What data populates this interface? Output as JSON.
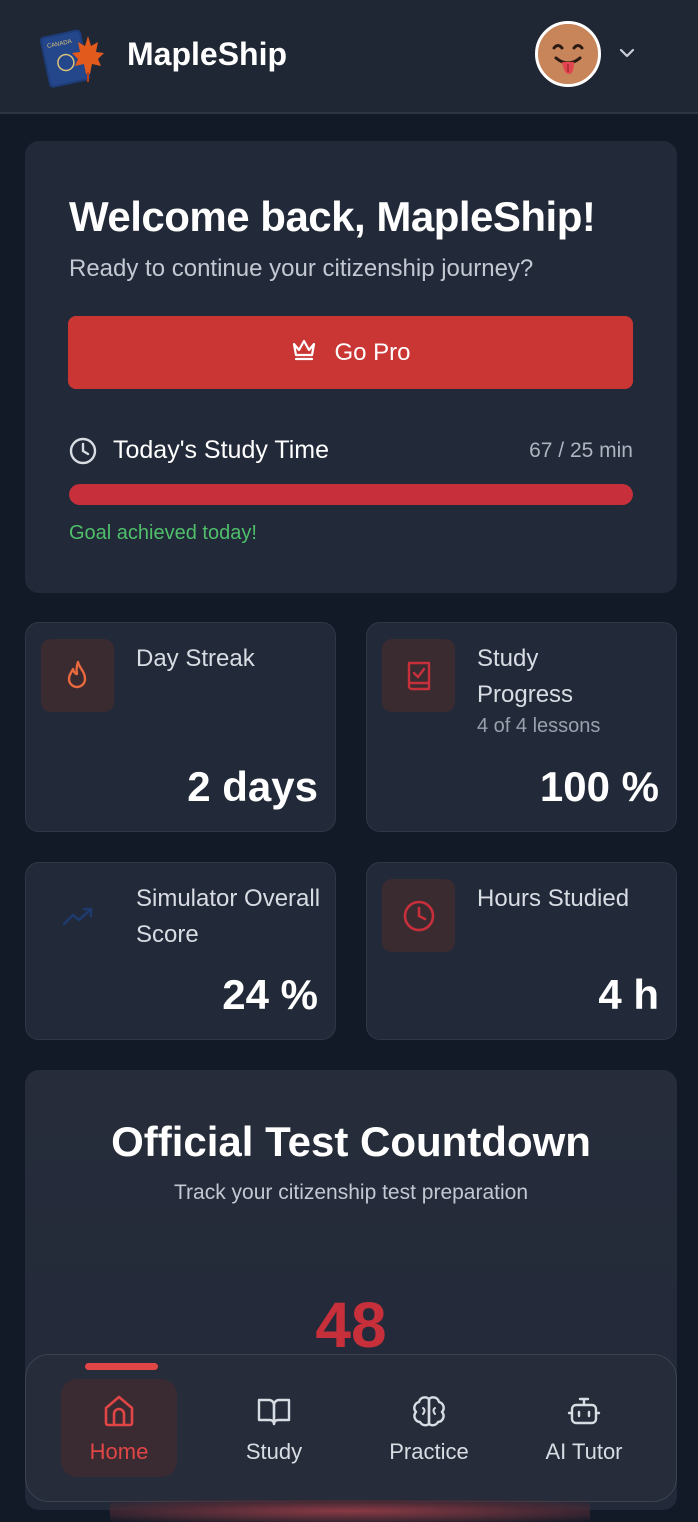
{
  "header": {
    "brand": "MapleShip",
    "logo_icon": "canada-passport-maple-leaf-logo",
    "avatar_icon": "tongue-out-emoji-avatar",
    "menu_icon": "chevron-down-icon"
  },
  "welcome": {
    "title": "Welcome back, MapleShip!",
    "subtitle": "Ready to continue your citizenship journey?",
    "go_pro_label": "Go Pro",
    "go_pro_icon": "crown-icon",
    "study_time_label": "Today's Study Time",
    "study_time_value": "67 / 25 min",
    "study_progress_fraction": 1.0,
    "goal_message": "Goal achieved today!"
  },
  "stats": {
    "day_streak": {
      "label": "Day Streak",
      "value": "2 days",
      "icon": "flame-icon"
    },
    "study_progress": {
      "label": "Study Progress",
      "sublabel": "4 of 4 lessons",
      "value": "100 %",
      "icon": "book-check-icon"
    },
    "simulator": {
      "label": "Simulator Overall Score",
      "value": "24 %",
      "icon": "trending-up-icon"
    },
    "hours": {
      "label": "Hours Studied",
      "value": "4 h",
      "icon": "clock-icon"
    }
  },
  "countdown": {
    "title": "Official Test Countdown",
    "subtitle": "Track your citizenship test preparation",
    "number": "48"
  },
  "nav": {
    "items": [
      {
        "label": "Home",
        "icon": "home-icon",
        "active": true
      },
      {
        "label": "Study",
        "icon": "book-open-icon",
        "active": false
      },
      {
        "label": "Practice",
        "icon": "brain-icon",
        "active": false
      },
      {
        "label": "AI Tutor",
        "icon": "bot-icon",
        "active": false
      }
    ]
  },
  "colors": {
    "accent": "#c93633",
    "success": "#4fbf6b",
    "background": "#131a27",
    "card": "#222938"
  }
}
